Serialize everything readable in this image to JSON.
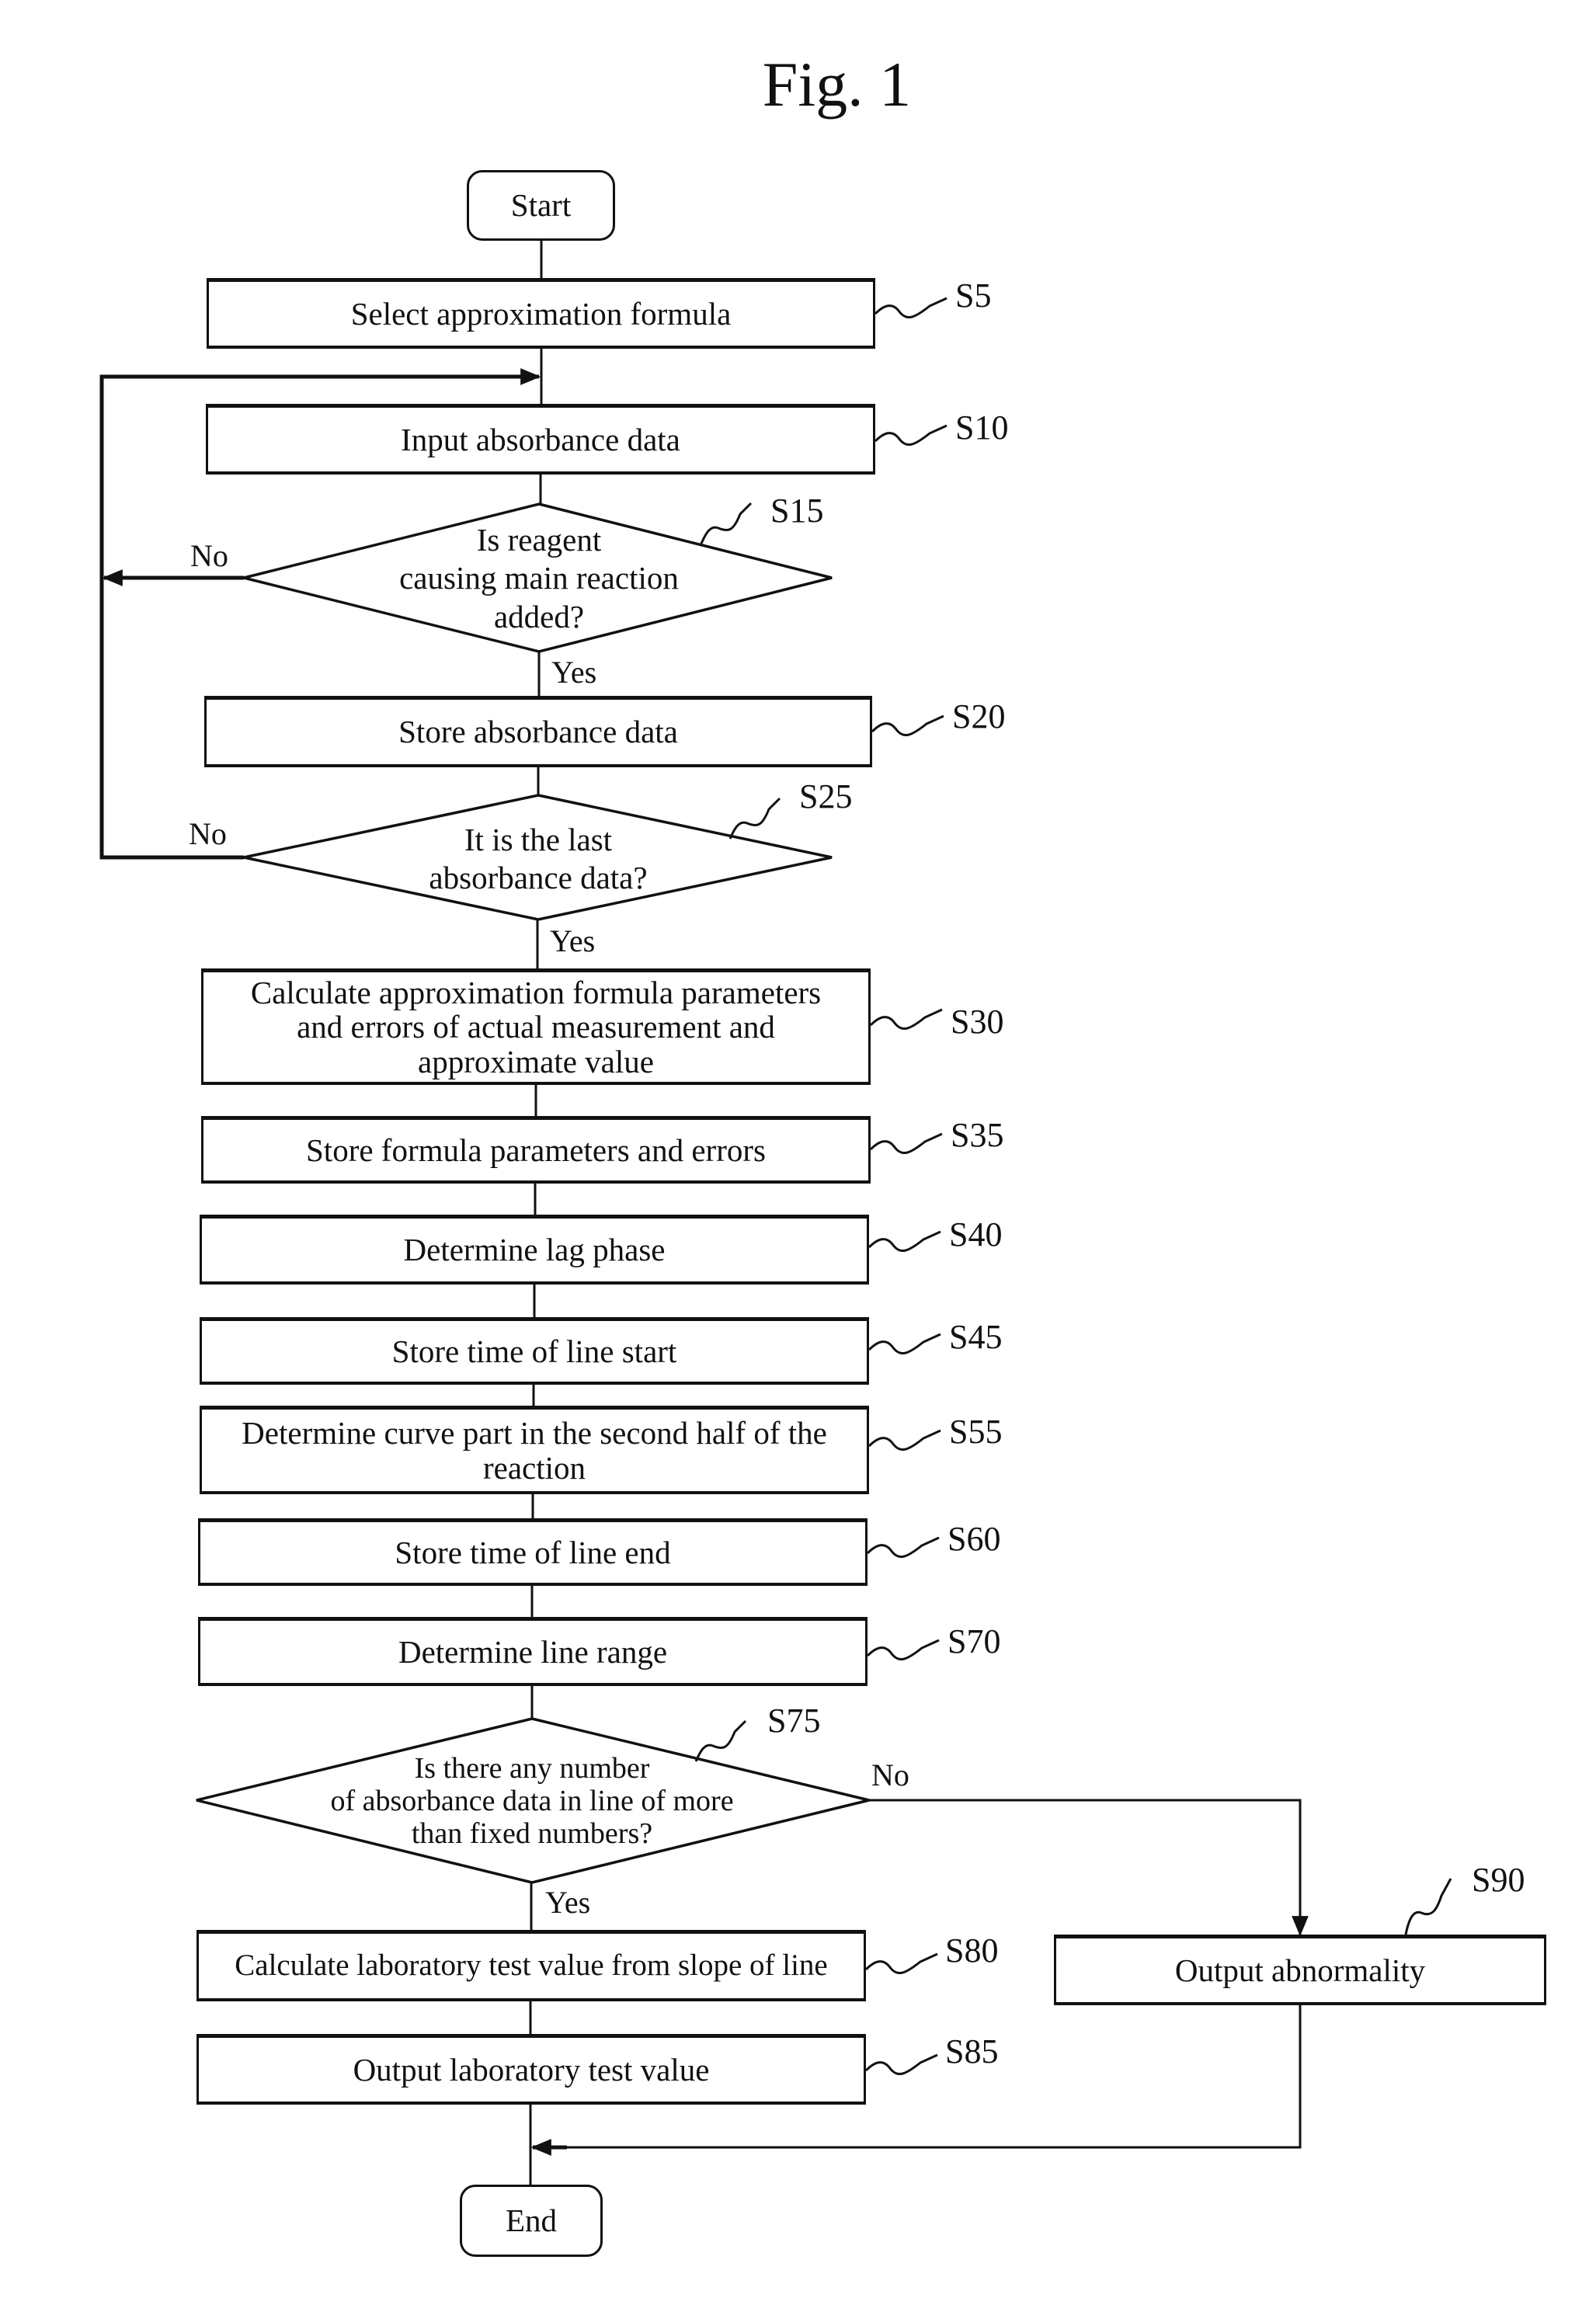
{
  "figure": {
    "title": "Fig. 1"
  },
  "terminals": {
    "start": "Start",
    "end": "End"
  },
  "steps": {
    "s5": {
      "id": "S5",
      "text": "Select approximation formula"
    },
    "s10": {
      "id": "S10",
      "text": "Input absorbance data"
    },
    "s15": {
      "id": "S15",
      "lines": [
        "Is reagent",
        "causing main reaction",
        "added?"
      ]
    },
    "s20": {
      "id": "S20",
      "text": "Store absorbance data"
    },
    "s25": {
      "id": "S25",
      "lines": [
        "It is the last",
        "absorbance data?"
      ]
    },
    "s30": {
      "id": "S30",
      "lines": [
        "Calculate approximation formula parameters",
        "and errors of actual measurement and",
        "approximate value"
      ]
    },
    "s35": {
      "id": "S35",
      "text": "Store formula parameters and errors"
    },
    "s40": {
      "id": "S40",
      "text": "Determine lag phase"
    },
    "s45": {
      "id": "S45",
      "text": "Store time of line start"
    },
    "s55": {
      "id": "S55",
      "lines": [
        "Determine curve part in the second half of the",
        "reaction"
      ]
    },
    "s60": {
      "id": "S60",
      "text": "Store time of line end"
    },
    "s70": {
      "id": "S70",
      "text": "Determine line range"
    },
    "s75": {
      "id": "S75",
      "lines": [
        "Is there any number",
        "of absorbance data in line of more",
        "than fixed numbers?"
      ]
    },
    "s80": {
      "id": "S80",
      "text": "Calculate laboratory test value from slope of line"
    },
    "s85": {
      "id": "S85",
      "text": "Output laboratory test value"
    },
    "s90": {
      "id": "S90",
      "text": "Output abnormality"
    }
  },
  "branches": {
    "s15_no": "No",
    "s15_yes": "Yes",
    "s25_no": "No",
    "s25_yes": "Yes",
    "s75_no": "No",
    "s75_yes": "Yes"
  }
}
